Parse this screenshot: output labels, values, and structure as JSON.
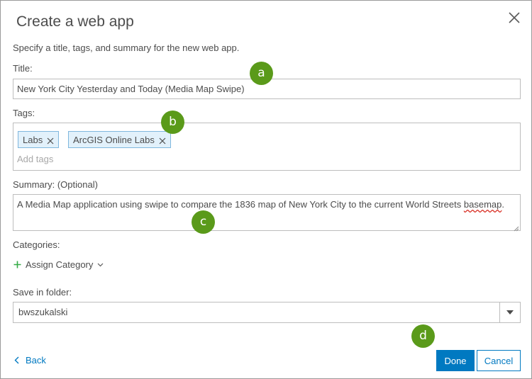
{
  "dialog": {
    "title": "Create a web app",
    "intro": "Specify a title, tags, and summary for the new web app.",
    "close_icon": "close-icon"
  },
  "fields": {
    "title_label": "Title:",
    "title_value": "New York City Yesterday and Today (Media Map Swipe)",
    "tags_label": "Tags:",
    "tags": [
      "Labs",
      "ArcGIS Online Labs"
    ],
    "tags_placeholder": "Add tags",
    "summary_label": "Summary: (Optional)",
    "summary_before": "A Media Map application using swipe to compare the 1836 map of New York City to the current World Streets ",
    "summary_misspelled": "basemap",
    "summary_after": ".",
    "categories_label": "Categories:",
    "assign_category": "Assign Category",
    "folder_label": "Save in folder:",
    "folder_value": "bwszukalski"
  },
  "footer": {
    "back": "Back",
    "done": "Done",
    "cancel": "Cancel"
  },
  "callouts": [
    "a",
    "b",
    "c",
    "d"
  ],
  "colors": {
    "accent": "#0079c1",
    "callout": "#5a9a1a",
    "tag_bg": "#e2f1fb",
    "tag_border": "#7fb7de",
    "add_icon": "#35ac46"
  }
}
